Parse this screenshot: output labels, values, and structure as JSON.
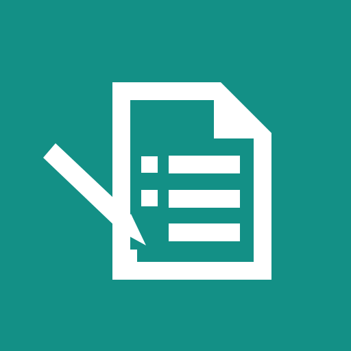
{
  "icon": {
    "name": "document-checklist-edit-icon",
    "background_color": "#139086",
    "foreground_color": "#ffffff"
  }
}
